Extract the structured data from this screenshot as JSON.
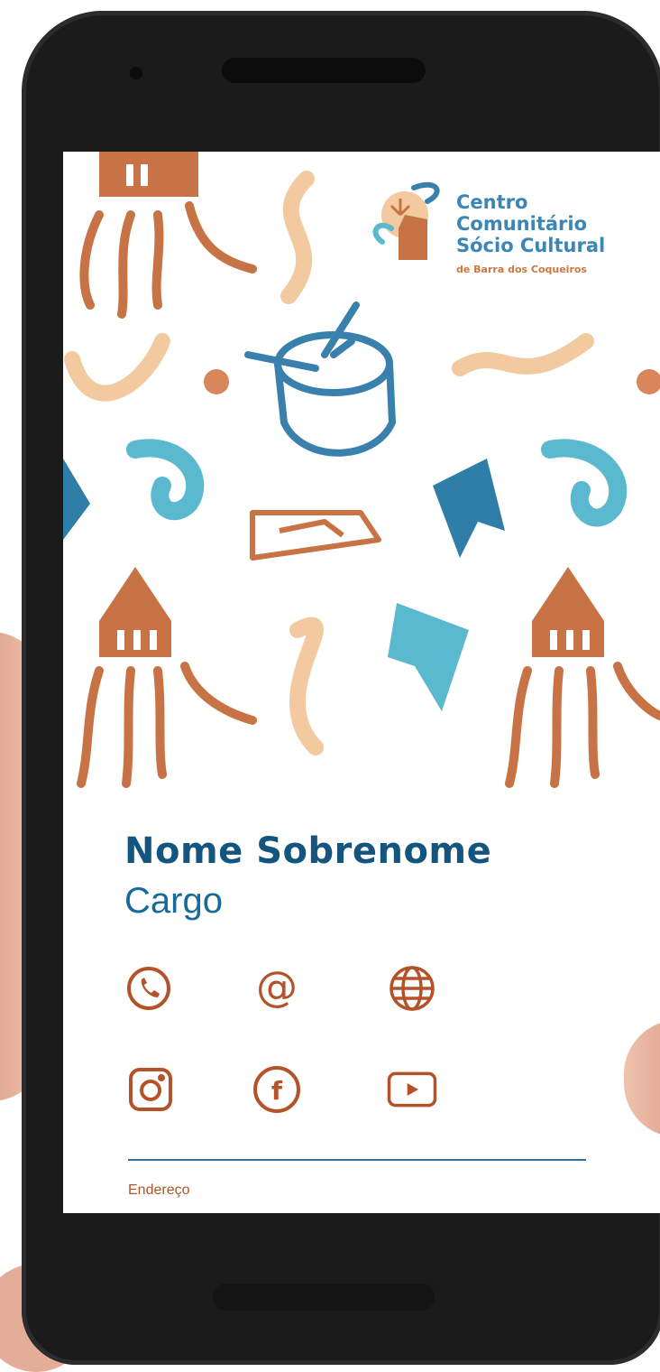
{
  "card": {
    "logo": {
      "line1": "Centro",
      "line2": "Comunitário",
      "line3": "Sócio Cultural",
      "subtitle": "de Barra dos Coqueiros"
    },
    "name": "Nome Sobrenome",
    "role": "Cargo",
    "address": "Endereço"
  },
  "contact_icons": [
    {
      "name": "phone-icon"
    },
    {
      "name": "email-icon"
    },
    {
      "name": "globe-icon"
    },
    {
      "name": "instagram-icon"
    },
    {
      "name": "facebook-icon"
    },
    {
      "name": "youtube-icon"
    }
  ],
  "colors": {
    "accent_orange": "#b4532a",
    "accent_blue": "#14557f",
    "accent_cyan": "#5ab8cf",
    "accent_peach": "#f3caa0"
  }
}
